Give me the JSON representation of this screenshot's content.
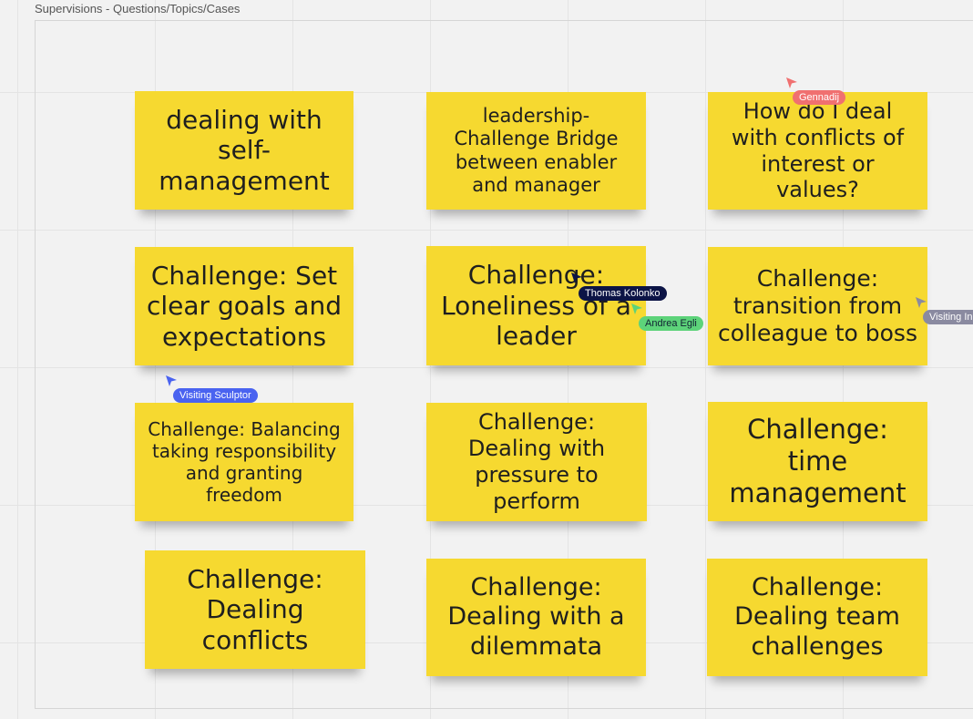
{
  "frame": {
    "title": "Supervisions - Questions/Topics/Cases"
  },
  "notes": [
    {
      "text": "dealing with self-management"
    },
    {
      "text": "leadership-Challenge Bridge between enabler and manager"
    },
    {
      "text": "How do I deal with conflicts of interest or values?"
    },
    {
      "text": "Challenge: Set clear goals and expectations"
    },
    {
      "text": "Challenge: Loneliness of a leader"
    },
    {
      "text": "Challenge: transition from colleague to boss"
    },
    {
      "text": "Challenge: Balancing taking responsibility and granting freedom"
    },
    {
      "text": "Challenge: Dealing with pressure to perform"
    },
    {
      "text": "Challenge: time management"
    },
    {
      "text": "Challenge: Dealing conflicts"
    },
    {
      "text": "Challenge: Dealing with a dilemmata"
    },
    {
      "text": "Challenge: Dealing team challenges"
    }
  ],
  "collaborators": [
    {
      "name": "Gennadij",
      "color": "#f07070"
    },
    {
      "name": "Thomas Kolonko",
      "color": "#0c1446"
    },
    {
      "name": "Andrea Egli",
      "color": "#5dd37a"
    },
    {
      "name": "Visiting Sculptor",
      "color": "#4a63f0"
    },
    {
      "name": "Visiting In",
      "color": "#8a8aa0"
    }
  ],
  "colors": {
    "sticky_note": "#f6d930",
    "canvas": "#f2f2f2"
  }
}
